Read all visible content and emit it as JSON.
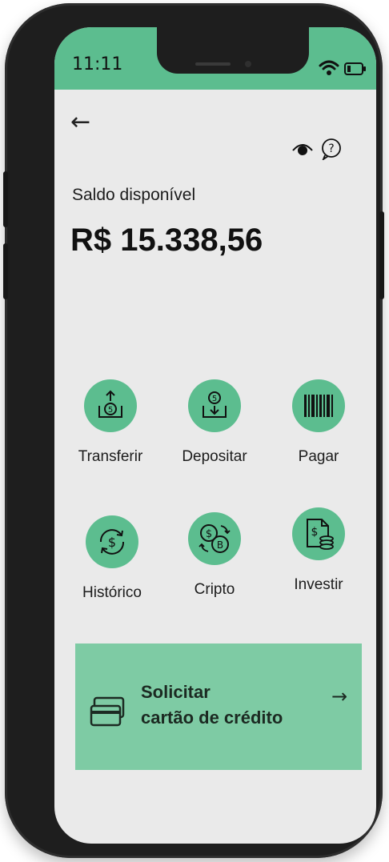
{
  "status_bar": {
    "time": "11:11",
    "background": "#5cbd8f"
  },
  "header": {
    "back_icon": "arrow-left-icon",
    "hide_balance_icon": "eye-icon",
    "help_icon": "question-bubble-icon"
  },
  "balance": {
    "label": "Saldo disponível",
    "value": "R$ 15.338,56"
  },
  "actions": [
    {
      "label": "Transferir",
      "icon": "transfer-icon"
    },
    {
      "label": "Depositar",
      "icon": "deposit-icon"
    },
    {
      "label": "Pagar",
      "icon": "barcode-icon"
    },
    {
      "label": "Histórico",
      "icon": "history-icon"
    },
    {
      "label": "Cripto",
      "icon": "crypto-icon"
    },
    {
      "label": "Investir",
      "icon": "invest-icon"
    }
  ],
  "banner": {
    "line1": "Solicitar",
    "line2": "cartão de crédito",
    "arrow": "→",
    "icon": "credit-card-icon",
    "background": "#7ecba4"
  },
  "colors": {
    "accent": "#5cbd8f",
    "screen_background": "#eaeaea",
    "phone_body": "#1e1e1e"
  }
}
